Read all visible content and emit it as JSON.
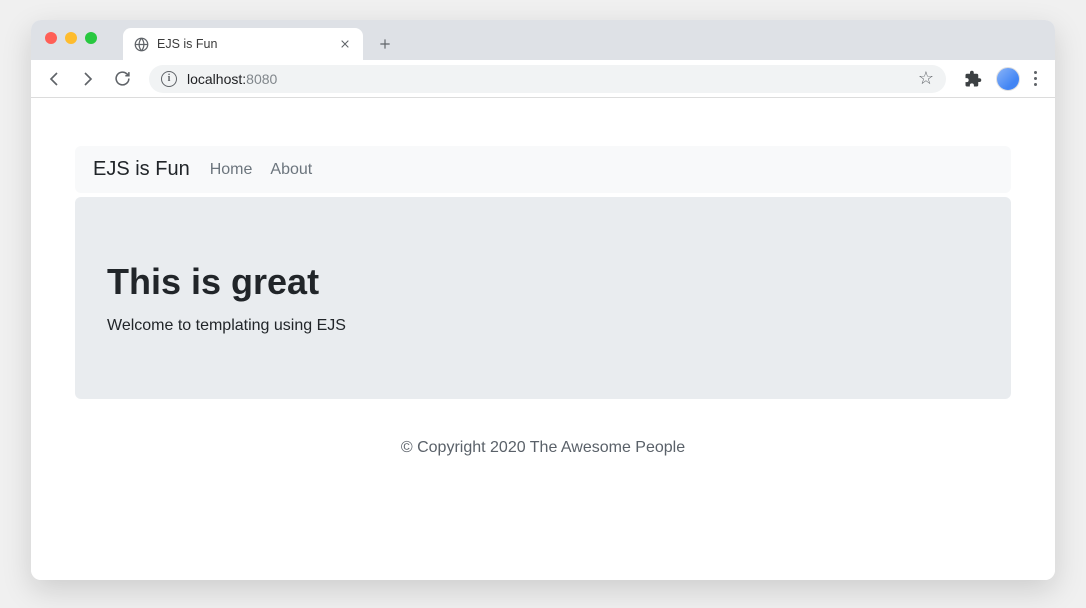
{
  "browser": {
    "tab": {
      "title": "EJS is Fun"
    },
    "url": {
      "host": "localhost:",
      "port": "8080"
    }
  },
  "page": {
    "navbar": {
      "brand": "EJS is Fun",
      "links": [
        "Home",
        "About"
      ]
    },
    "jumbotron": {
      "heading": "This is great",
      "text": "Welcome to templating using EJS"
    },
    "footer": "© Copyright 2020 The Awesome People"
  }
}
